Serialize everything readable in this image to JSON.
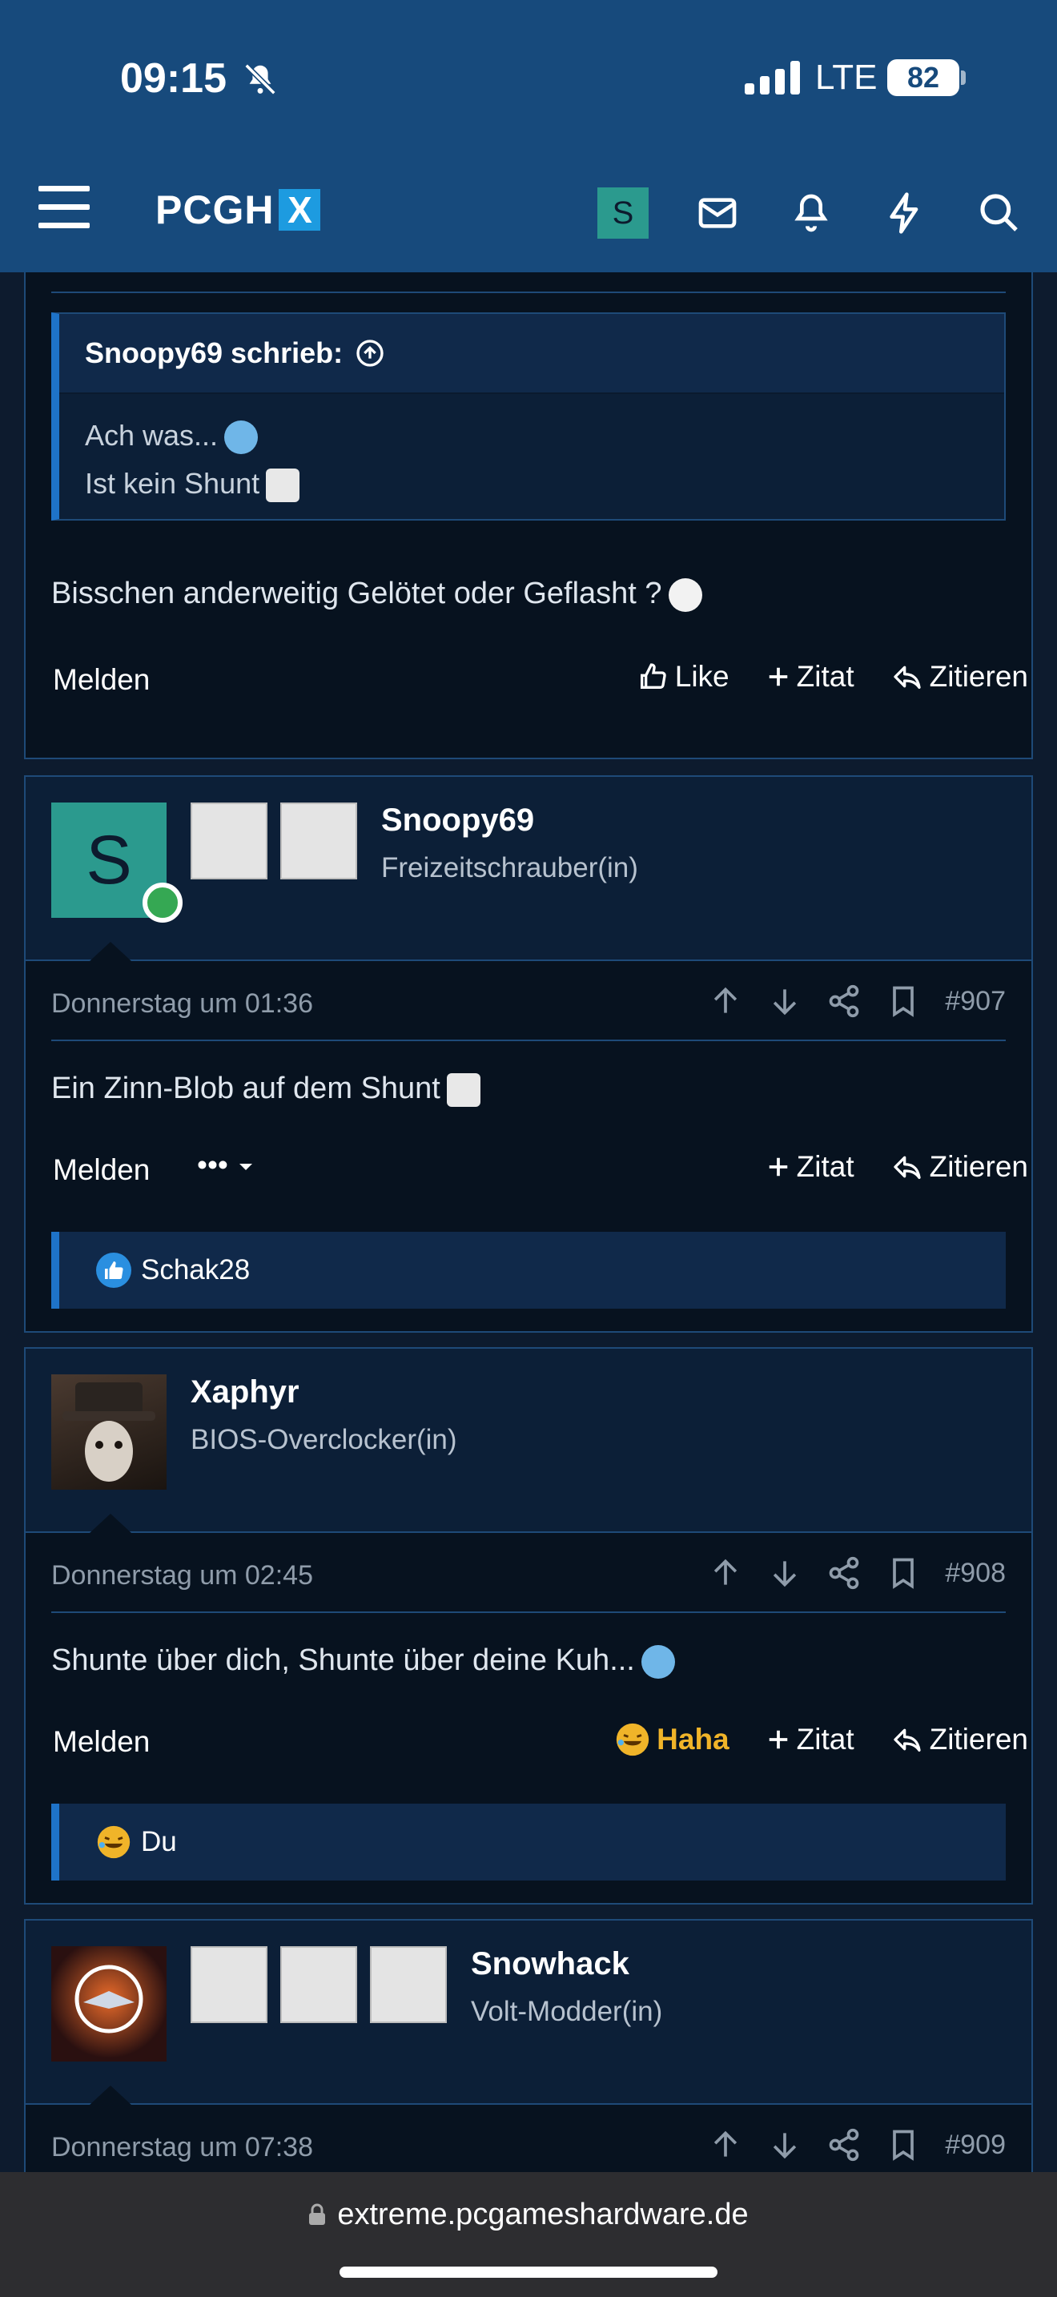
{
  "status_bar": {
    "time": "09:15",
    "network": "LTE",
    "battery": "82"
  },
  "header": {
    "logo_text": "PCGH",
    "logo_x": "X",
    "user_initial": "S"
  },
  "post_906": {
    "quote_author": "Snoopy69 schrieb:",
    "quote_lines": [
      "Ach was...",
      "Ist kein Shunt"
    ],
    "text": "Bisschen anderweitig Gelötet oder Geflasht ?",
    "melden": "Melden",
    "like": "Like",
    "zitat": "Zitat",
    "zitieren": "Zitieren"
  },
  "post_907": {
    "avatar_letter": "S",
    "username": "Snoopy69",
    "user_title": "Freizeitschrauber(in)",
    "date": "Donnerstag um 01:36",
    "number": "#907",
    "text": "Ein Zinn-Blob auf dem Shunt",
    "melden": "Melden",
    "more": "•••",
    "zitat": "Zitat",
    "zitieren": "Zitieren",
    "reaction_user": "Schak28"
  },
  "post_908": {
    "username": "Xaphyr",
    "user_title": "BIOS-Overclocker(in)",
    "date": "Donnerstag um 02:45",
    "number": "#908",
    "text": "Shunte über dich, Shunte über deine Kuh...",
    "melden": "Melden",
    "haha": "Haha",
    "zitat": "Zitat",
    "zitieren": "Zitieren",
    "reaction_user": "Du"
  },
  "post_909": {
    "username": "Snowhack",
    "user_title": "Volt-Modder(in)",
    "date": "Donnerstag um 07:38",
    "number": "#909"
  },
  "browser": {
    "url": "extreme.pcgameshardware.de"
  },
  "colors": {
    "header_bg": "#174a7c",
    "accent": "#1e73c8",
    "teal_avatar": "#2b9a8e",
    "haha": "#f0b429"
  }
}
